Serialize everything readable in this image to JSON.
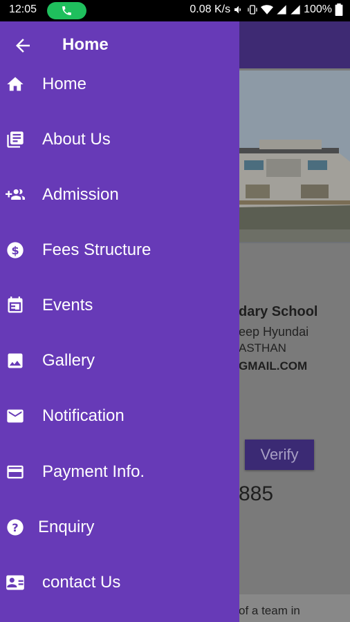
{
  "status_bar": {
    "time": "12:05",
    "network_speed": "0.08 K/s",
    "battery": "100%"
  },
  "drawer": {
    "title": "Home",
    "items": [
      {
        "label": "Home",
        "icon": "home-icon"
      },
      {
        "label": "About Us",
        "icon": "library-books-icon"
      },
      {
        "label": "Admission",
        "icon": "group-add-icon"
      },
      {
        "label": "Fees Structure",
        "icon": "dollar-circle-icon"
      },
      {
        "label": "Events",
        "icon": "calendar-icon"
      },
      {
        "label": "Gallery",
        "icon": "image-icon"
      },
      {
        "label": "Notification",
        "icon": "mail-icon"
      },
      {
        "label": "Payment Info.",
        "icon": "credit-card-icon"
      },
      {
        "label": "Enquiry",
        "icon": "help-circle-icon"
      },
      {
        "label": "contact Us",
        "icon": "contact-card-icon"
      }
    ]
  },
  "background": {
    "school_name": "dary School",
    "address_line1": "eep Hyundai",
    "address_line2": "ASTHAN",
    "email": "GMAIL.COM",
    "verify_label": "Verify",
    "number": "885",
    "bottom_text": "of a team in"
  },
  "colors": {
    "drawer": "#673ab7",
    "status_bar": "#000000",
    "call_pill": "#1fbf5d"
  }
}
